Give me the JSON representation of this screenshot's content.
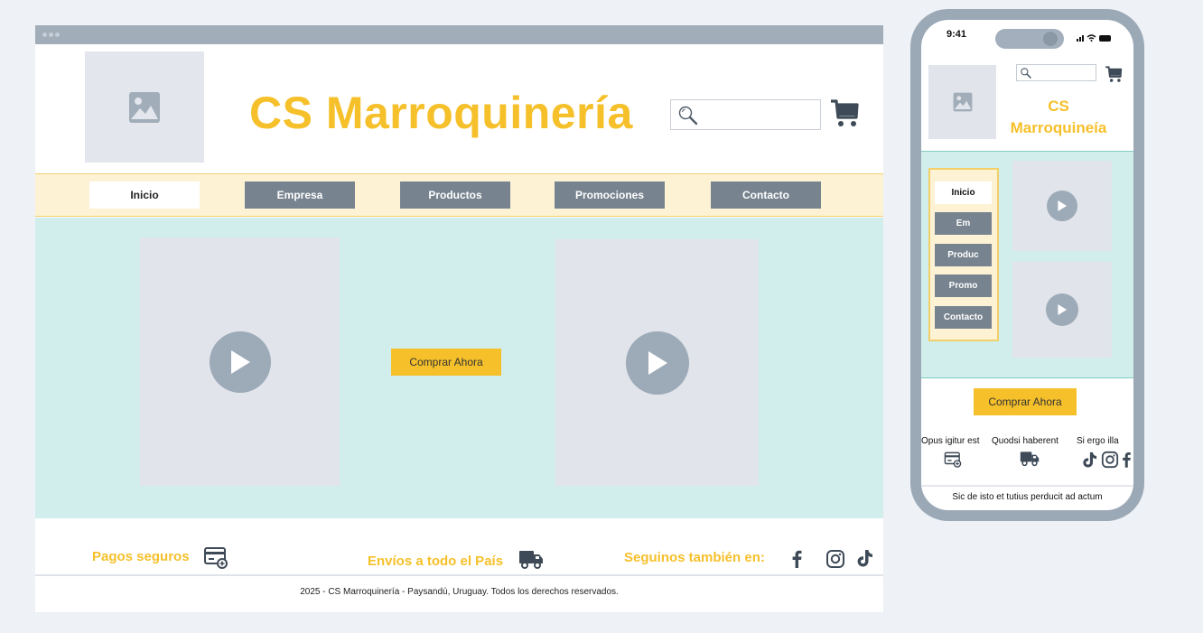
{
  "desktop": {
    "brand_title": "CS Marroquinería",
    "search": {
      "placeholder": ""
    },
    "nav": [
      {
        "label": "Inicio",
        "active": true
      },
      {
        "label": "Empresa",
        "active": false
      },
      {
        "label": "Productos",
        "active": false
      },
      {
        "label": "Promociones",
        "active": false
      },
      {
        "label": "Contacto",
        "active": false
      }
    ],
    "hero": {
      "buy_label": "Comprar Ahora"
    },
    "features": {
      "payments": "Pagos seguros",
      "shipping": "Envíos a todo el País",
      "social": "Seguinos también en:"
    },
    "copyright": "2025 - CS Marroquinería - Paysandú, Uruguay. Todos los derechos reservados."
  },
  "phone": {
    "time": "9:41",
    "brand_title_line1": "CS",
    "brand_title_line2": "Marroquineía",
    "nav": [
      {
        "label": "Inicio",
        "active": true
      },
      {
        "label": "Em",
        "active": false
      },
      {
        "label": "Produc",
        "active": false
      },
      {
        "label": "Promo",
        "active": false
      },
      {
        "label": "Contacto",
        "active": false
      }
    ],
    "buy_label": "Comprar Ahora",
    "features": [
      "Opus igitur est",
      "Quodsi haberent",
      "Si ergo illa"
    ],
    "footer": "Sic de isto et tutius perducit ad actum"
  },
  "colors": {
    "accent": "#f6c02a",
    "nav_bg": "#fdf3d4",
    "hero_bg": "#d1edec",
    "button_gray": "#77838f",
    "placeholder": "#e1e4eb"
  },
  "icons": [
    "image-icon",
    "search-icon",
    "cart-icon",
    "play-icon",
    "credit-card-icon",
    "truck-icon",
    "facebook-icon",
    "instagram-icon",
    "tiktok-icon",
    "signal-icon",
    "wifi-icon",
    "battery-icon"
  ]
}
